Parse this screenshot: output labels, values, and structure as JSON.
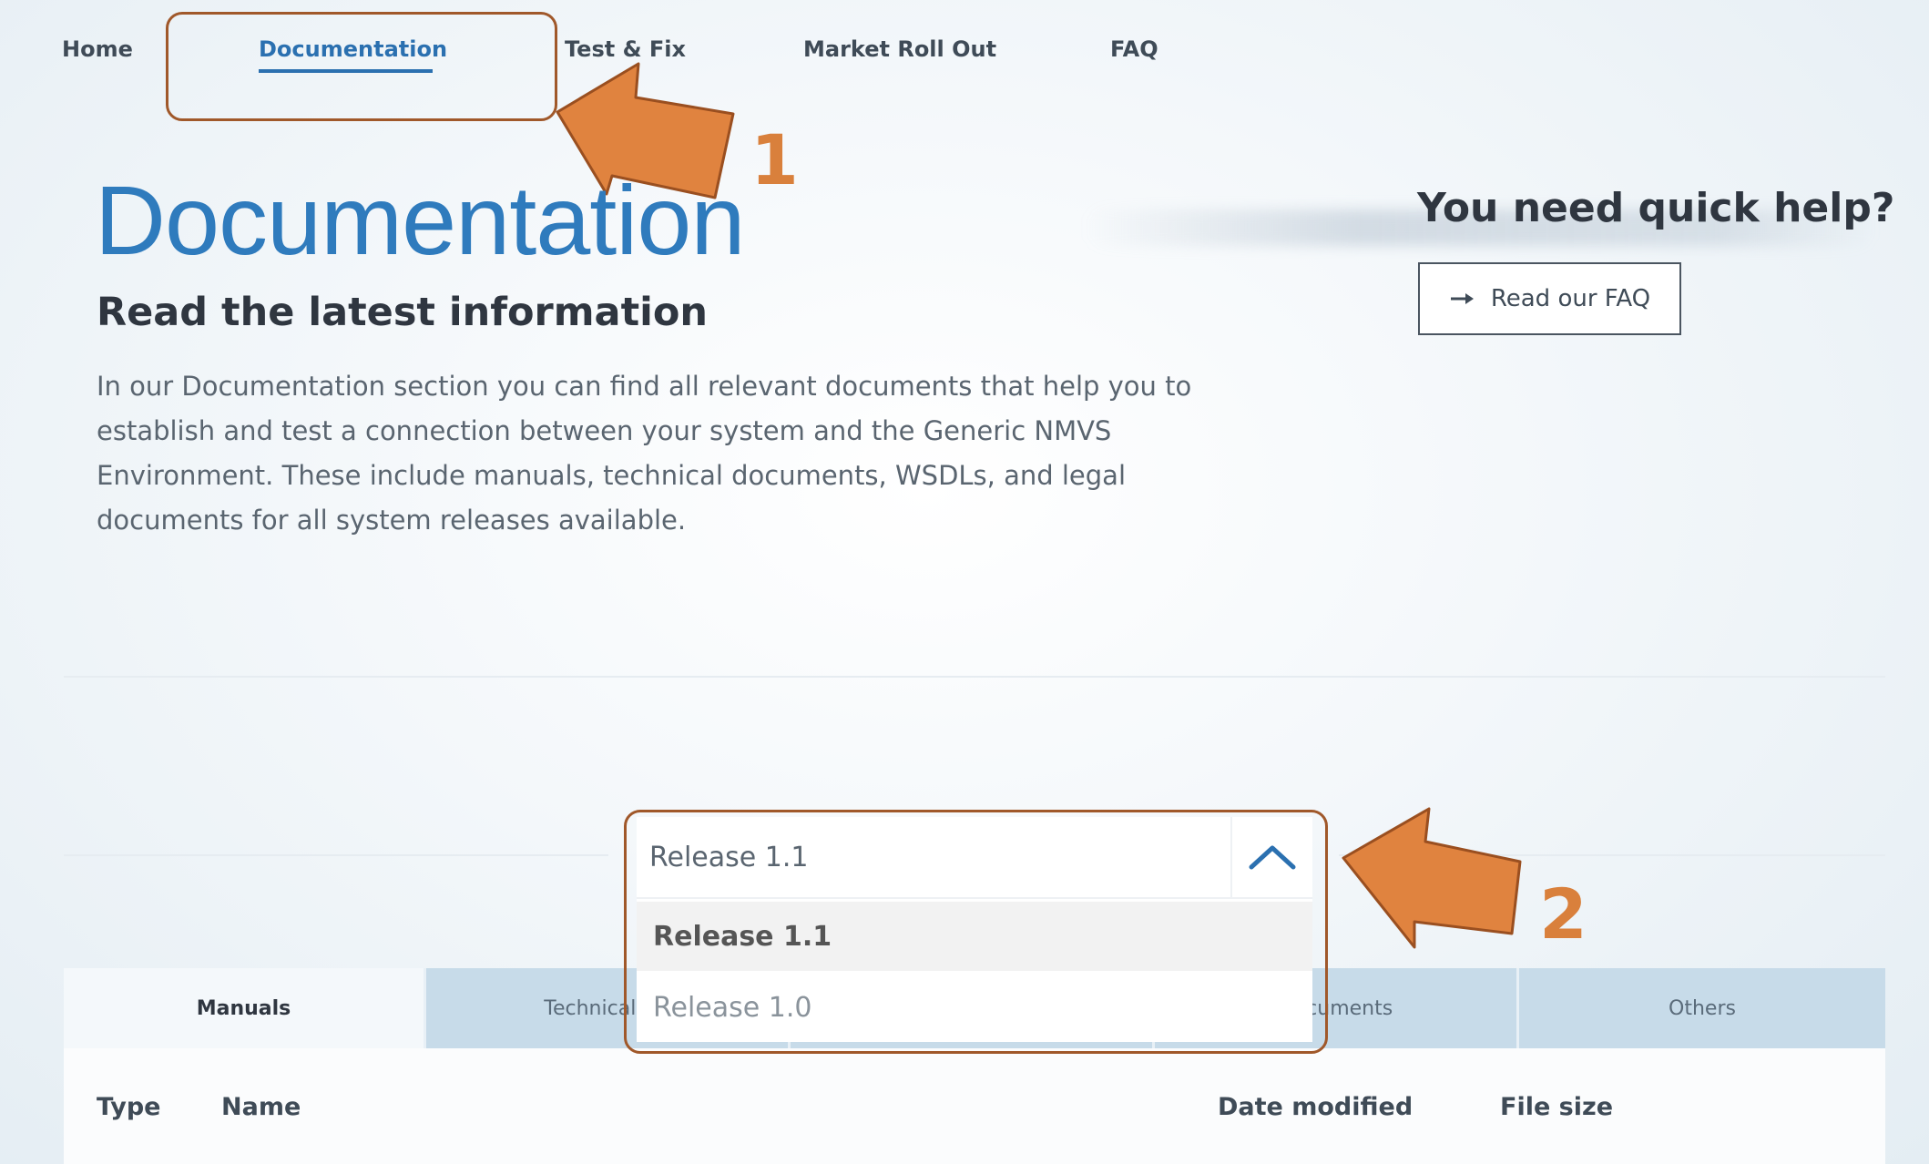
{
  "nav": {
    "home": "Home",
    "documentation": "Documentation",
    "test_fix": "Test & Fix",
    "market_roll_out": "Market Roll Out",
    "faq": "FAQ"
  },
  "annotations": {
    "step1": "1",
    "step2": "2",
    "accent_color": "#d9803c",
    "border_color": "#a0582a"
  },
  "hero": {
    "title": "Documentation",
    "subtitle": "Read the latest information",
    "intro": "In our Documentation section you can find all relevant documents that help you to establish and test a connection between your system and the Generic NMVS Environment. These include manuals, technical documents, WSDLs, and legal documents for all system releases available."
  },
  "help": {
    "heading": "You need quick help?",
    "button_label": "Read our FAQ",
    "button_icon": "arrow-right-icon"
  },
  "release_select": {
    "current_value": "Release 1.1",
    "toggle_icon": "chevron-up-icon",
    "options": [
      "Release 1.1",
      "Release 1.0"
    ]
  },
  "tabs": [
    {
      "label": "Manuals"
    },
    {
      "label": "Technical Do"
    },
    {
      "label": ""
    },
    {
      "label": "Documents"
    },
    {
      "label": "Others"
    }
  ],
  "table": {
    "columns": [
      "Type",
      "Name",
      "Date modified",
      "File size"
    ]
  },
  "colors": {
    "brand_blue": "#2b70b0",
    "tab_inactive": "#c7dbe9"
  }
}
